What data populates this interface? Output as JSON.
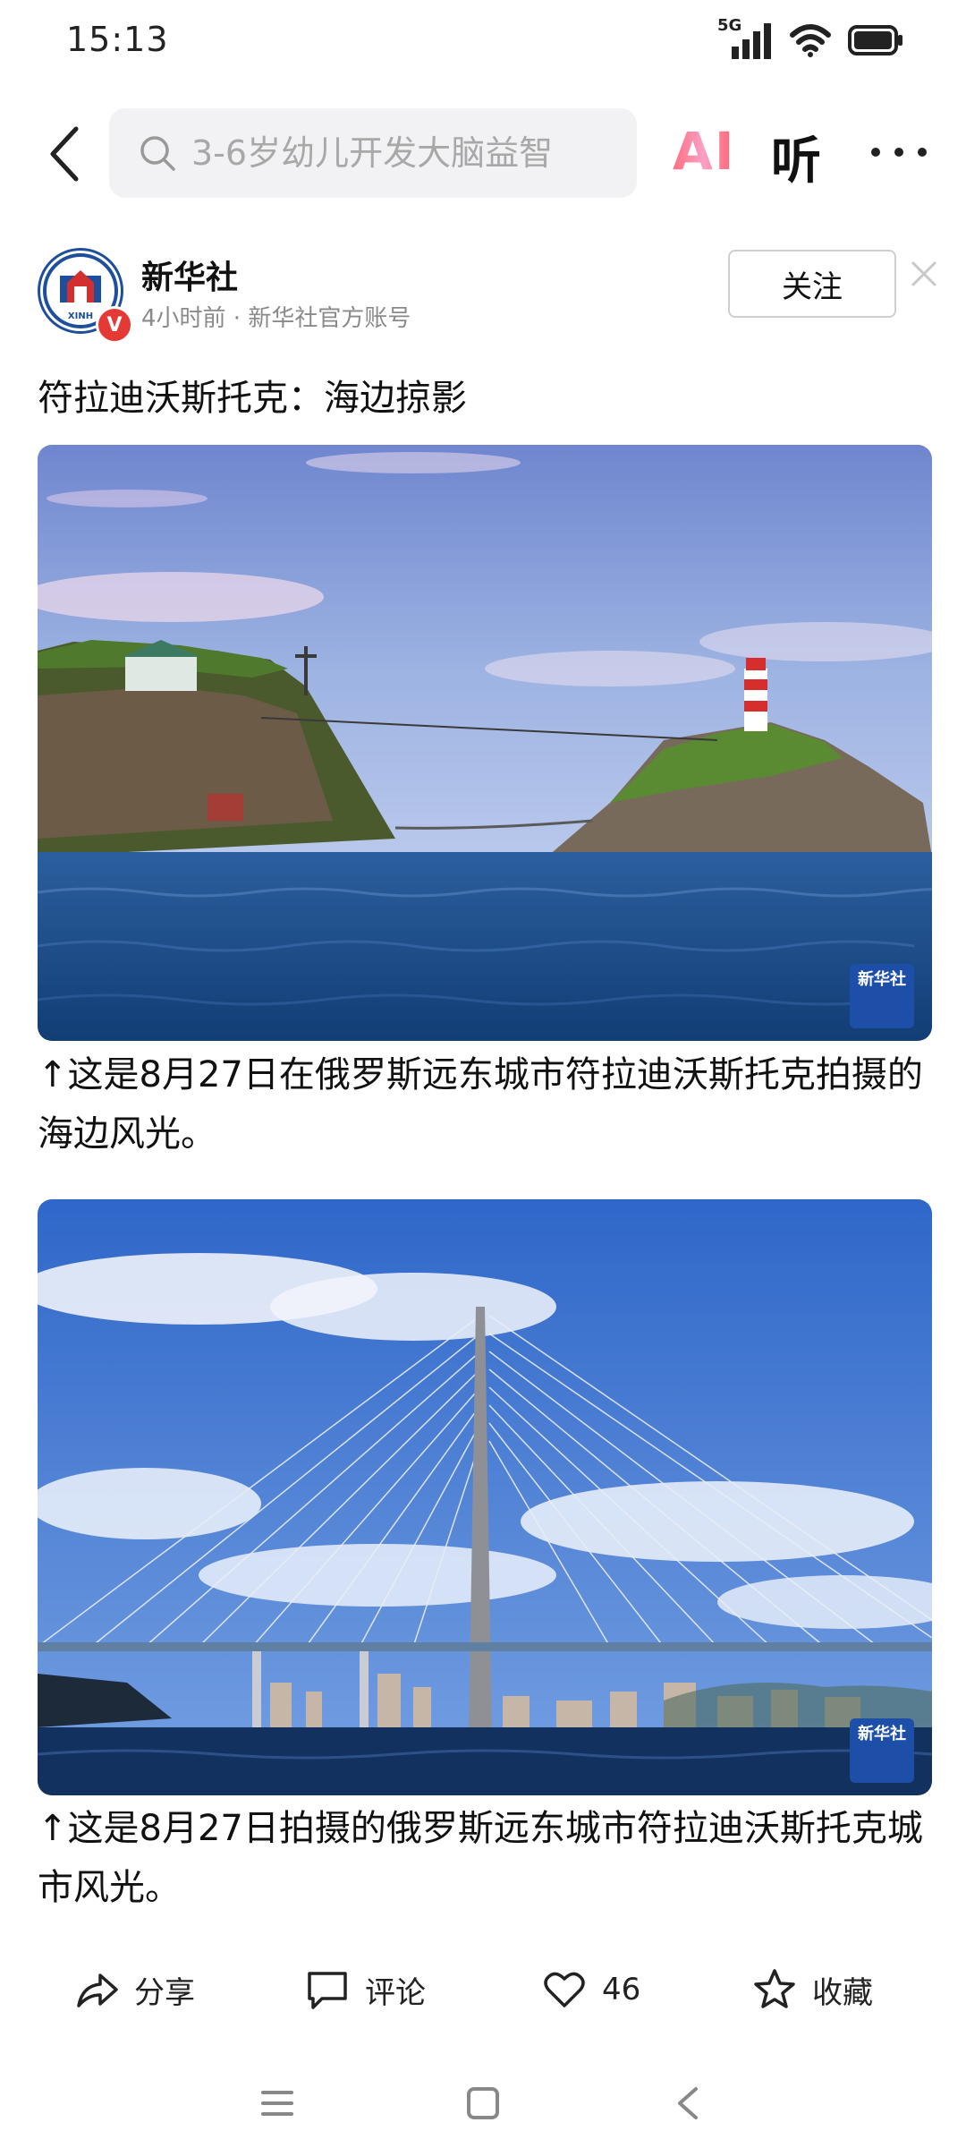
{
  "status_bar": {
    "time": "15:13",
    "network": "5G"
  },
  "nav": {
    "search_placeholder": "3-6岁幼儿开发大脑益智",
    "ai_label": "AI",
    "listen_label": "听"
  },
  "author": {
    "name": "新华社",
    "meta": "4小时前 · 新华社官方账号",
    "follow_label": "关注",
    "verified_label": "V"
  },
  "article": {
    "title": "符拉迪沃斯托克：海边掠影",
    "images": [
      {
        "watermark": "新华社"
      },
      {
        "watermark": "新华社"
      }
    ],
    "captions": [
      "↑这是8月27日在俄罗斯远东城市符拉迪沃斯托克拍摄的海边风光。",
      "↑这是8月27日拍摄的俄罗斯远东城市符拉迪沃斯托克城市风光。"
    ]
  },
  "actions": {
    "share_label": "分享",
    "comment_label": "评论",
    "like_count": "46",
    "favorite_label": "收藏"
  }
}
